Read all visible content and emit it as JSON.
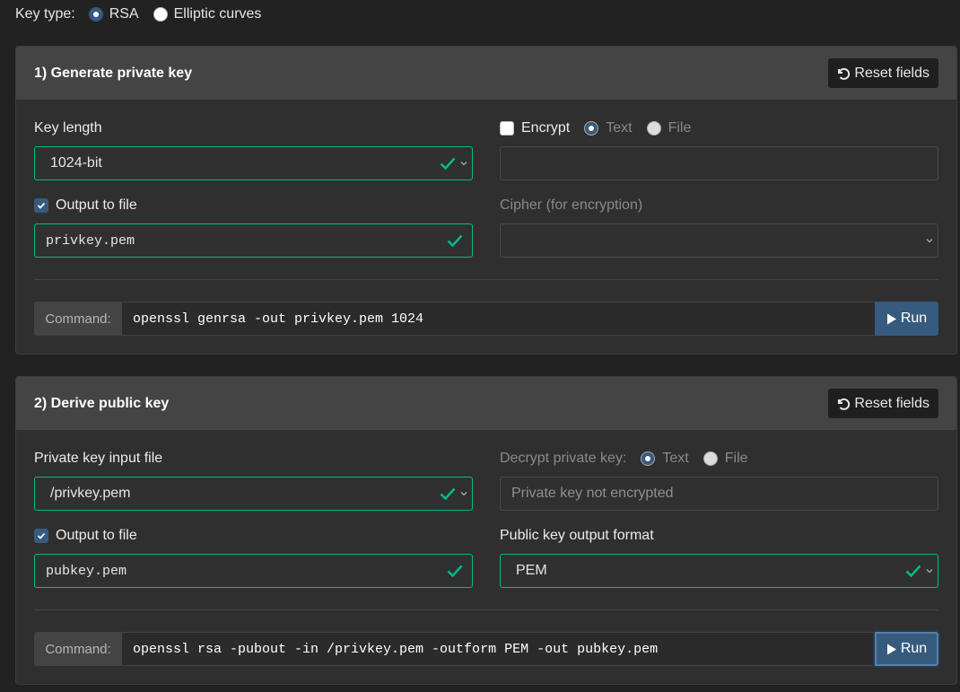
{
  "key_type": {
    "label": "Key type:",
    "options": [
      "RSA",
      "Elliptic curves"
    ],
    "selected": "RSA"
  },
  "section1": {
    "title": "1) Generate private key",
    "reset_label": "Reset fields",
    "key_length_label": "Key length",
    "key_length_value": "1024-bit",
    "encrypt_label": "Encrypt",
    "encrypt_checked": false,
    "encrypt_mode_options": [
      "Text",
      "File"
    ],
    "encrypt_mode_selected": "Text",
    "encrypt_value": "",
    "output_to_file_label": "Output to file",
    "output_to_file_checked": true,
    "output_file_value": "privkey.pem",
    "cipher_label": "Cipher (for encryption)",
    "cipher_value": "",
    "command_label": "Command:",
    "command_value": "openssl genrsa -out privkey.pem 1024",
    "run_label": "Run"
  },
  "section2": {
    "title": "2) Derive public key",
    "reset_label": "Reset fields",
    "input_file_label": "Private key input file",
    "input_file_value": "/privkey.pem",
    "decrypt_label": "Decrypt private key:",
    "decrypt_mode_options": [
      "Text",
      "File"
    ],
    "decrypt_mode_selected": "Text",
    "decrypt_placeholder": "Private key not encrypted",
    "output_to_file_label": "Output to file",
    "output_to_file_checked": true,
    "output_file_value": "pubkey.pem",
    "format_label": "Public key output format",
    "format_value": "PEM",
    "command_label": "Command:",
    "command_value": "openssl rsa -pubout -in /privkey.pem -outform PEM -out pubkey.pem",
    "run_label": "Run"
  },
  "colors": {
    "background": "#222222",
    "card": "#2f2f2f",
    "card_header": "#444444",
    "accent": "#375a7f",
    "valid": "#00bc8c"
  }
}
